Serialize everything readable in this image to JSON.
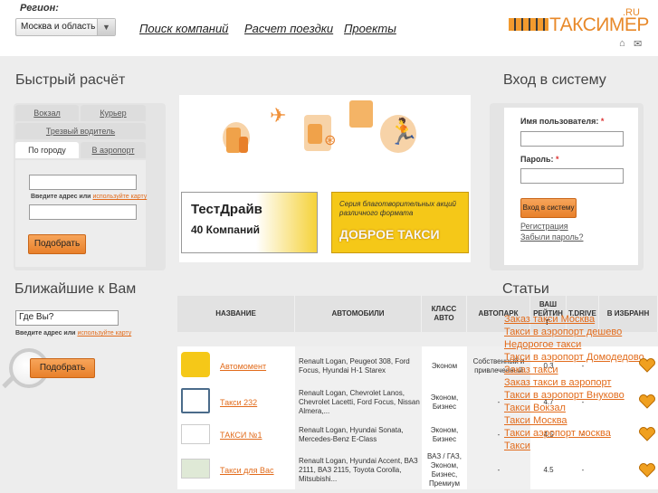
{
  "header": {
    "region_label": "Регион:",
    "region_value": "Москва и область",
    "nav": [
      "Поиск компаний",
      "Расчет поездки",
      "Проекты"
    ],
    "logo_text": "ТАКСИМЕР",
    "logo_suffix": ".RU"
  },
  "quick_calc": {
    "title": "Быстрый расчёт",
    "tabs_row1": [
      "Вокзал",
      "Курьер"
    ],
    "tabs_row2": [
      "Трезвый водитель"
    ],
    "tabs_row3": [
      "По городу",
      "В аэропорт"
    ],
    "hint_prefix": "Введите адрес или",
    "hint_link": "используйте карту",
    "button": "Подобрать"
  },
  "banners": {
    "testdrive_line1": "ТестДрайв",
    "testdrive_line2": "40 Компаний",
    "charity_line1": "Серия благотворительных акций различного формата",
    "charity_line2": "ДОБРОЕ ТАКСИ"
  },
  "login": {
    "title": "Вход в систему",
    "username_label": "Имя пользователя:",
    "password_label": "Пароль:",
    "required": "*",
    "button": "Вход в систему",
    "register": "Регистрация",
    "forgot": "Забыли пароль?"
  },
  "nearest": {
    "title": "Ближайшие к Вам",
    "input_value": "Где Вы?",
    "hint_prefix": "Введите адрес или",
    "hint_link": "используйте карту",
    "button": "Подобрать"
  },
  "table": {
    "headers": [
      "НАЗВАНИЕ",
      "АВТОМОБИЛИ",
      "КЛАСС АВТО",
      "АВТОПАРК",
      "ВАШ РЕЙТИН Г",
      "T.DRIVE",
      "В ИЗБРАНН"
    ],
    "rows": [
      {
        "name": "Автомомент",
        "cars": "Renault Logan, Peugeot 308, Ford Focus, Hyundai H-1 Starex",
        "class": "Эконом",
        "park": "Собственный и привлеченный",
        "rating": "0.3",
        "tdrive": "-"
      },
      {
        "name": "Такси 232",
        "cars": "Renault Logan, Chevrolet Lanos, Chevrolet Lacetti, Ford Focus, Nissan Almera,...",
        "class": "Эконом, Бизнес",
        "park": "-",
        "rating": "4.7",
        "tdrive": "-"
      },
      {
        "name": "ТАКСИ №1",
        "cars": "Renault Logan, Hyundai Sonata, Mercedes-Benz E-Class",
        "class": "Эконом, Бизнес",
        "park": "-",
        "rating": "4.5",
        "tdrive": "-"
      },
      {
        "name": "Такси для Вас",
        "cars": "Renault Logan, Hyundai Accent, ВАЗ 2111, ВАЗ 2115, Toyota Corolla, Mitsubishi...",
        "class": "ВАЗ / ГАЗ, Эконом, Бизнес, Премиум",
        "park": "-",
        "rating": "4.5",
        "tdrive": "-"
      }
    ]
  },
  "articles": {
    "title": "Статьи",
    "items": [
      "Заказ такси Москва",
      "Такси в аэропорт дешево",
      "Недорогое такси",
      "Такси в аэропорт Домодедово",
      "Заказ такси",
      "Заказ такси в аэропорт",
      "Такси в аэропорт Внуково",
      "Такси Вокзал",
      "Такси Москва",
      "Такси аэропорт москва",
      "Такси"
    ]
  },
  "colors": {
    "accent": "#e26b1b",
    "button": "#f0913a",
    "band": "#ededed"
  }
}
